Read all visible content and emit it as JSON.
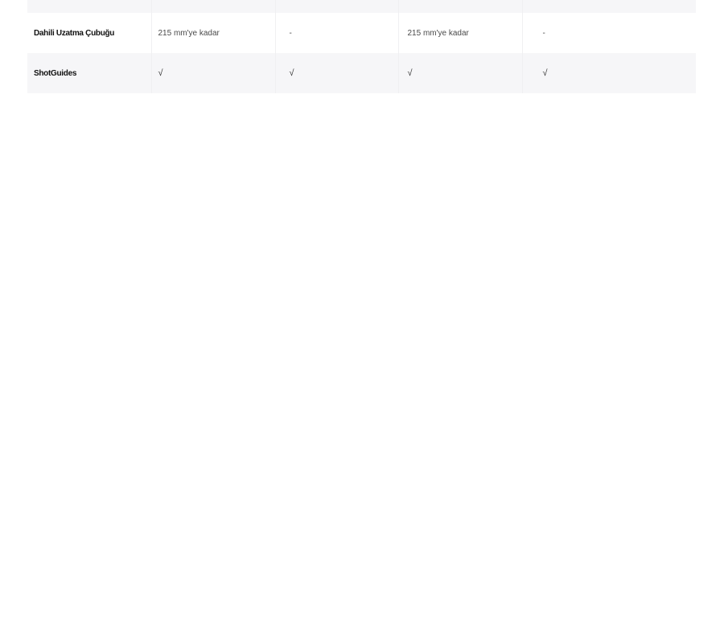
{
  "table": {
    "rows": [
      {
        "label": "",
        "cells": [
          "",
          "",
          "",
          ""
        ]
      },
      {
        "label": "Dahili Uzatma Çubuğu",
        "cells": [
          "215 mm'ye kadar",
          "-",
          "215 mm'ye kadar",
          "-"
        ]
      },
      {
        "label": "ShotGuides",
        "cells": [
          "√",
          "√",
          "√",
          "√"
        ]
      }
    ]
  }
}
